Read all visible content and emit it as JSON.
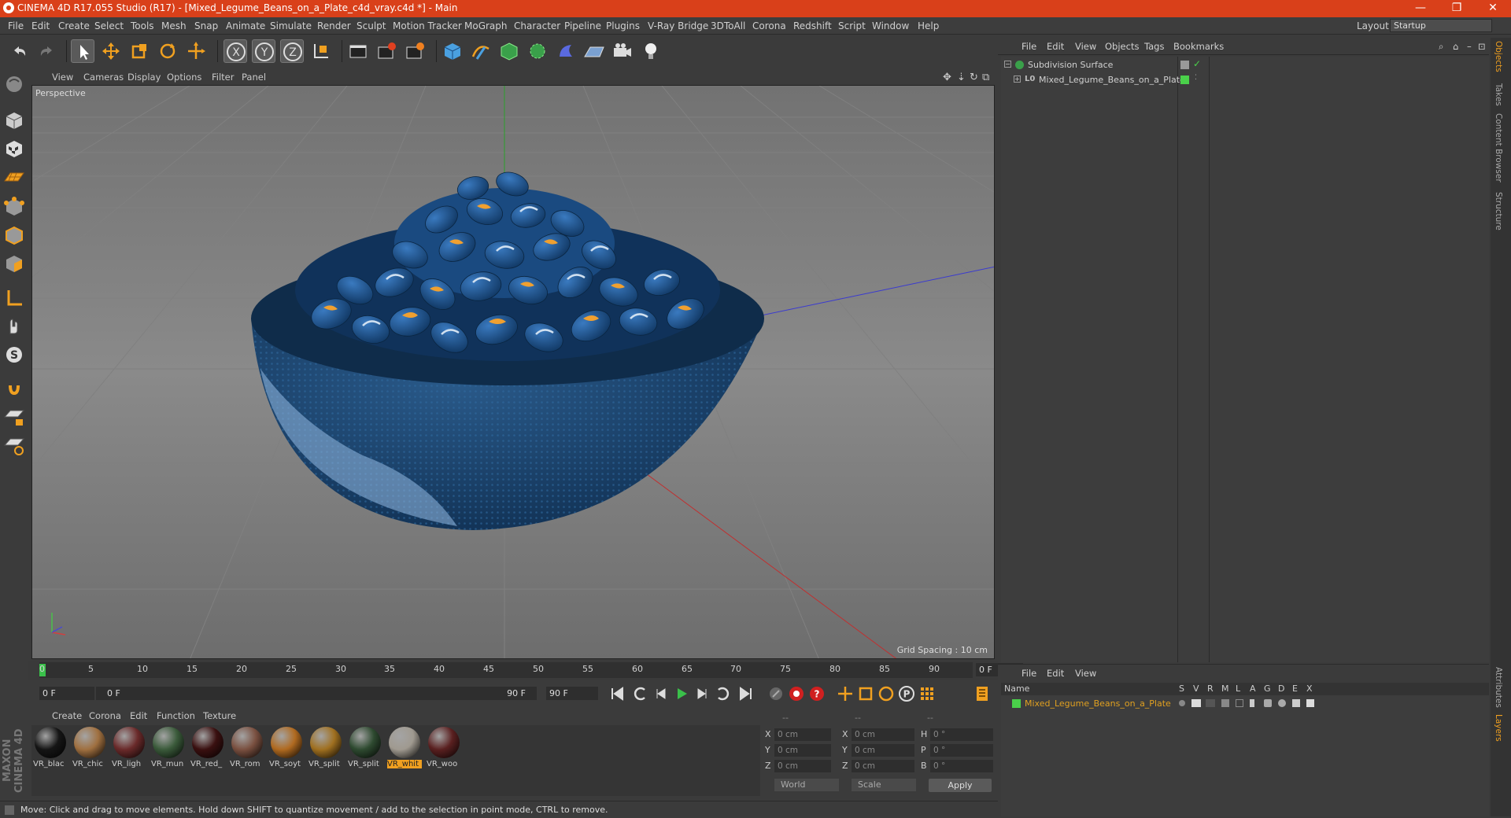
{
  "window": {
    "title": "CINEMA 4D R17.055 Studio (R17) - [Mixed_Legume_Beans_on_a_Plate_c4d_vray.c4d *] - Main",
    "minimize": "—",
    "restore": "❐",
    "close": "✕"
  },
  "menubar": {
    "items": [
      "File",
      "Edit",
      "Create",
      "Select",
      "Tools",
      "Mesh",
      "Snap",
      "Animate",
      "Simulate",
      "Render",
      "Sculpt",
      "Motion Tracker",
      "MoGraph",
      "Character",
      "Pipeline",
      "Plugins",
      "V-Ray Bridge",
      "3DToAll",
      "Corona",
      "Redshift",
      "Script",
      "Window",
      "Help"
    ],
    "layout_label": "Layout:",
    "layout_value": "Startup"
  },
  "viewport": {
    "menus": [
      "View",
      "Cameras",
      "Display",
      "Options",
      "Filter",
      "Panel"
    ],
    "label": "Perspective",
    "grid_spacing": "Grid Spacing : 10 cm"
  },
  "timeline": {
    "ticks": [
      "0",
      "5",
      "10",
      "15",
      "20",
      "25",
      "30",
      "35",
      "40",
      "45",
      "50",
      "55",
      "60",
      "65",
      "70",
      "75",
      "80",
      "85",
      "90"
    ],
    "current_frame": "0 F"
  },
  "playback": {
    "start": "0 F",
    "range_start": "0 F",
    "range_end": "90 F",
    "end": "90 F"
  },
  "materials": {
    "menus": [
      "Create",
      "Corona",
      "Edit",
      "Function",
      "Texture"
    ],
    "items": [
      {
        "label": "VR_blac",
        "color": "#151515"
      },
      {
        "label": "VR_chic",
        "color": "#a07040"
      },
      {
        "label": "VR_ligh",
        "color": "#6a2a2a"
      },
      {
        "label": "VR_mun",
        "color": "#3a5a3a"
      },
      {
        "label": "VR_red_",
        "color": "#3a1010"
      },
      {
        "label": "VR_rom",
        "color": "#7a5040"
      },
      {
        "label": "VR_soyt",
        "color": "#b06a20"
      },
      {
        "label": "VR_split",
        "color": "#a07020"
      },
      {
        "label": "VR_split",
        "color": "#2e4a30"
      },
      {
        "label": "VR_whit",
        "color": "#a09a90"
      },
      {
        "label": "VR_woo",
        "color": "#5a2020"
      }
    ],
    "active_index": 9
  },
  "coordinates": {
    "header": [
      "--",
      "--",
      "--"
    ],
    "rows": [
      {
        "a": "X",
        "av": "0 cm",
        "b": "X",
        "bv": "0 cm",
        "c": "H",
        "cv": "0 °"
      },
      {
        "a": "Y",
        "av": "0 cm",
        "b": "Y",
        "bv": "0 cm",
        "c": "P",
        "cv": "0 °"
      },
      {
        "a": "Z",
        "av": "0 cm",
        "b": "Z",
        "bv": "0 cm",
        "c": "B",
        "cv": "0 °"
      }
    ],
    "mode": "World",
    "scale": "Scale",
    "apply": "Apply"
  },
  "status": "Move: Click and drag to move elements. Hold down SHIFT to quantize movement / add to the selection in point mode, CTRL to remove.",
  "object_manager": {
    "menus": [
      "File",
      "Edit",
      "View",
      "Objects",
      "Tags",
      "Bookmarks"
    ],
    "objects": [
      {
        "name": "Subdivision Surface",
        "color": "#4ad04a"
      },
      {
        "name": "Mixed_Legume_Beans_on_a_Plate",
        "color": "#4ad04a"
      }
    ]
  },
  "layer_manager": {
    "menus": [
      "File",
      "Edit",
      "View"
    ],
    "columns": [
      "Name",
      "S",
      "V",
      "R",
      "M",
      "L",
      "A",
      "G",
      "D",
      "E",
      "X"
    ],
    "layers": [
      {
        "name": "Mixed_Legume_Beans_on_a_Plate",
        "color": "#e0a020"
      }
    ]
  },
  "right_tabs": [
    "Objects",
    "Takes",
    "Content Browser",
    "Structure",
    "Attributes",
    "Layers"
  ],
  "branding": "MAXON CINEMA 4D"
}
